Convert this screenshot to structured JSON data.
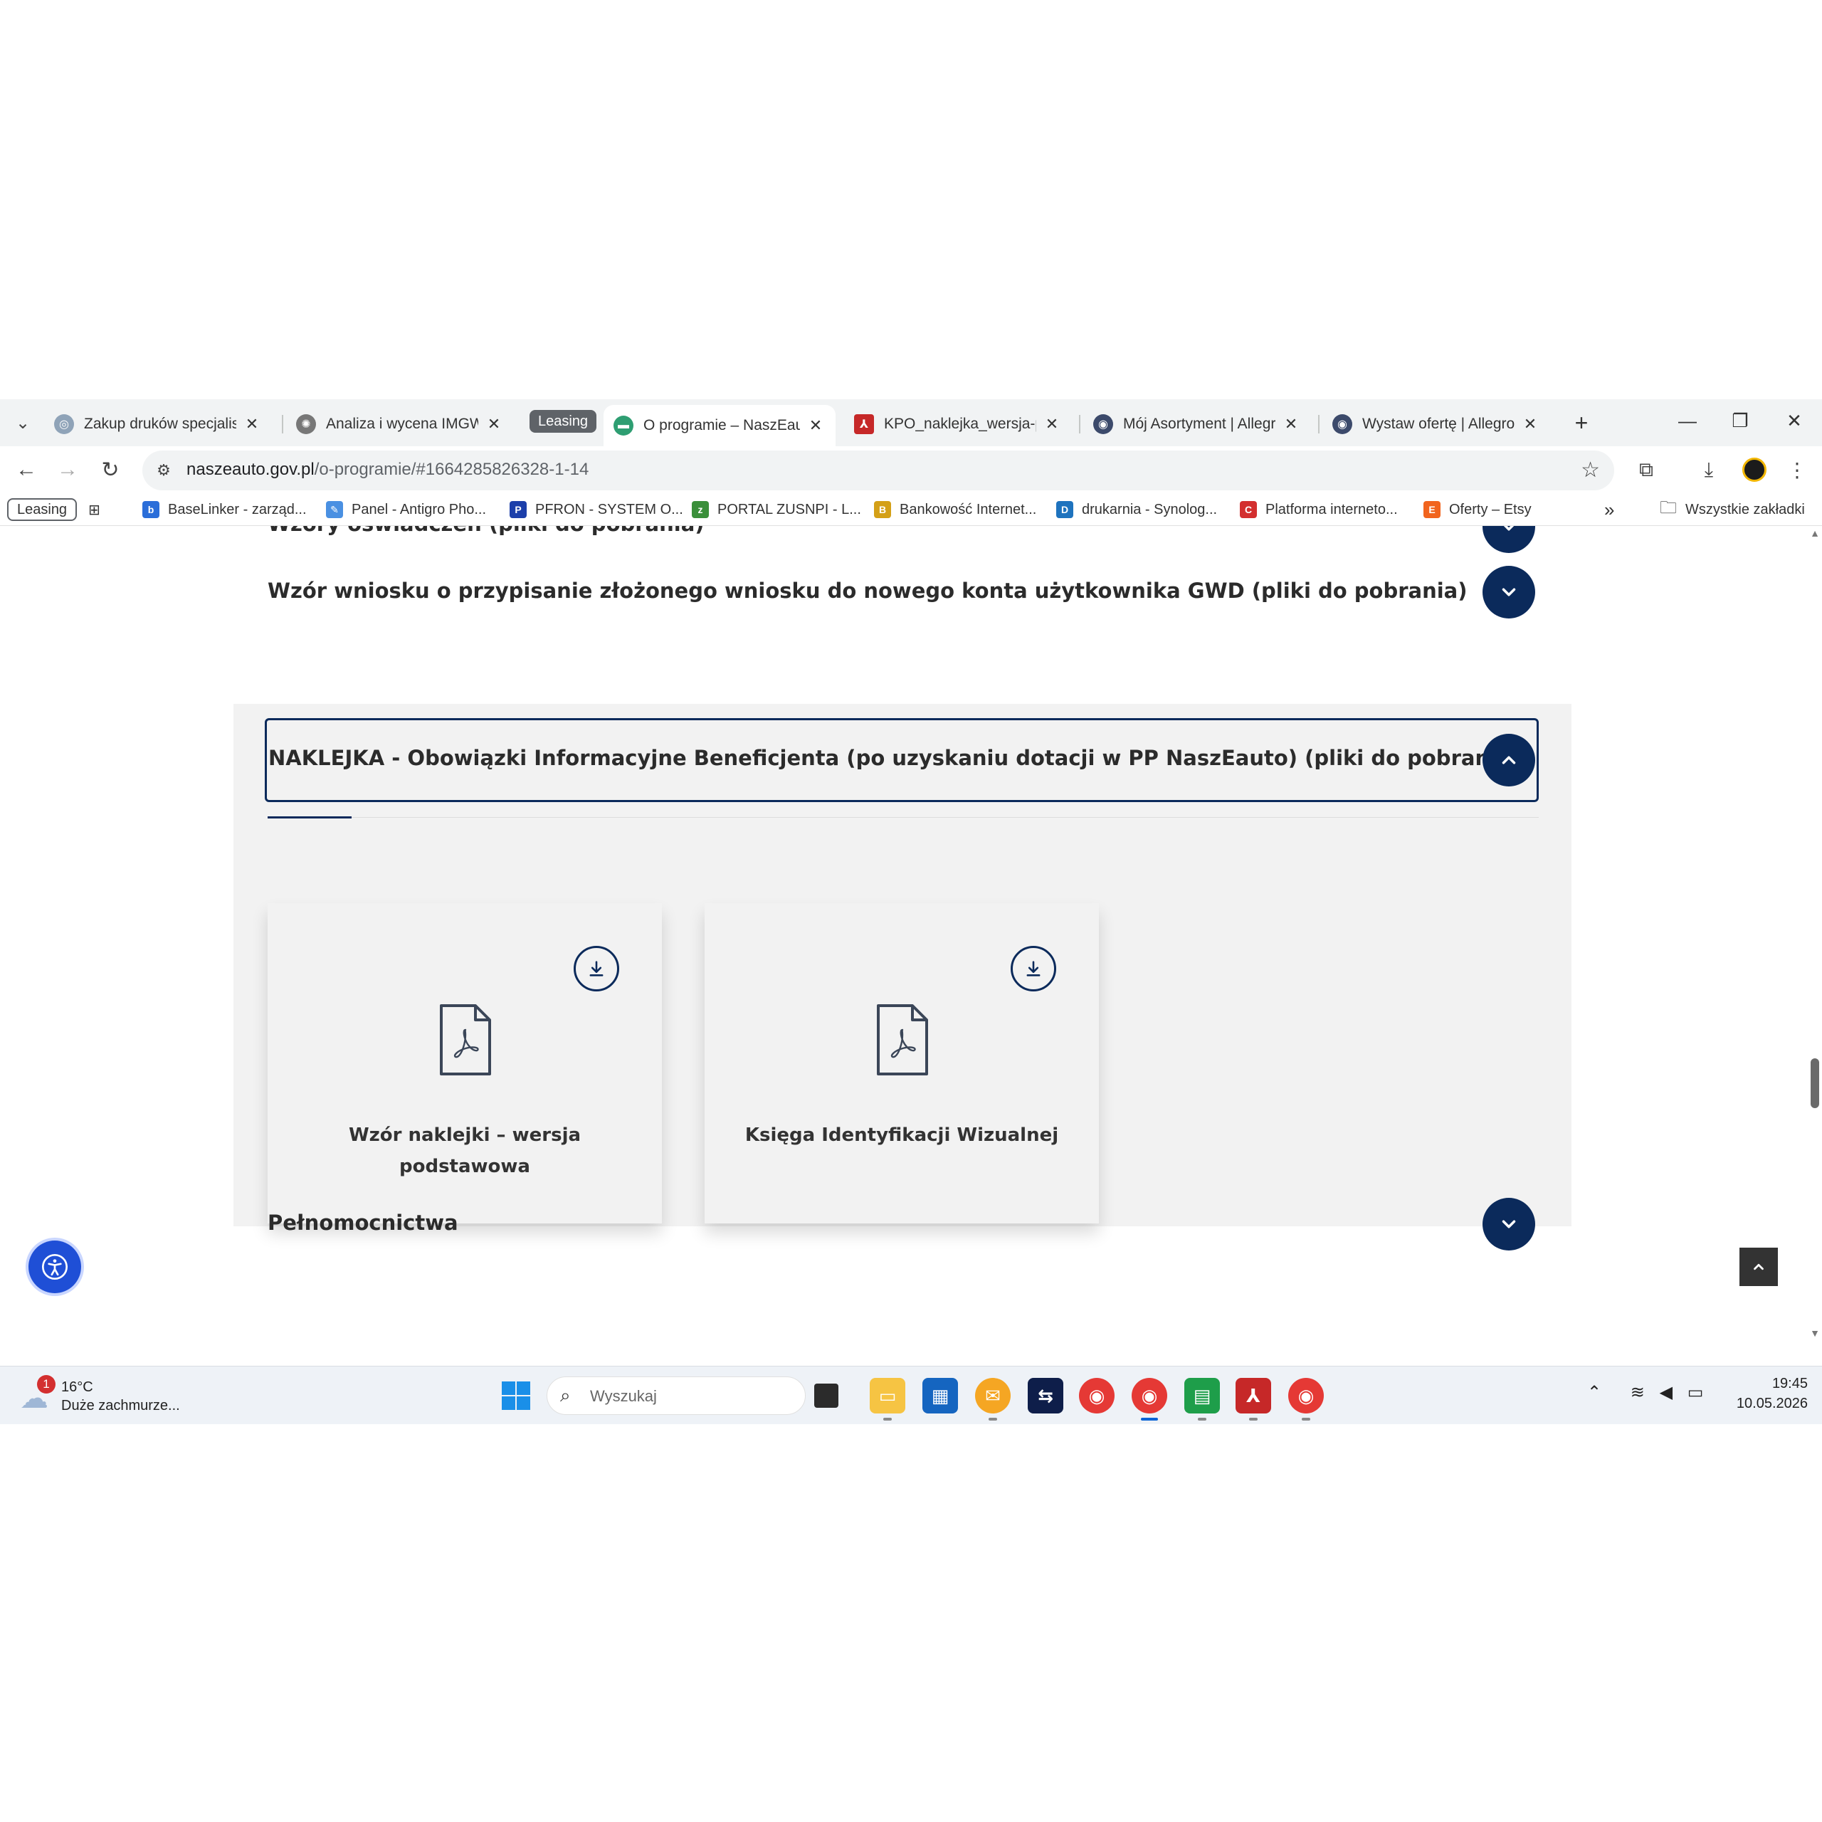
{
  "browser": {
    "tabs": [
      {
        "title": "Zakup druków specjalisty",
        "active": false
      },
      {
        "title": "Analiza i wycena IMGW",
        "active": false
      },
      {
        "title": "O programie – NaszEauto",
        "active": true
      },
      {
        "title": "KPO_naklejka_wersja-podstawowa",
        "active": false
      },
      {
        "title": "Mój Asortyment | Allegro",
        "active": false
      },
      {
        "title": "Wystaw ofertę | Allegro",
        "active": false
      }
    ],
    "tab_group_label": "Leasing",
    "url_domain": "naszeauto.gov.pl",
    "url_path": "/o-programie/#1664285826328-1-14",
    "bookmarks": {
      "group_label": "Leasing",
      "items": [
        "BaseLinker - zarząd...",
        "Panel - Antigro Pho...",
        "PFRON - SYSTEM O...",
        "PORTAL ZUSNPI - L...",
        "Bankowość Internet...",
        "drukarnia - Synolog...",
        "Platforma interneto...",
        "Oferty – Etsy"
      ],
      "overflow": "»",
      "all_bookmarks": "Wszystkie zakładki"
    }
  },
  "page": {
    "accordion_cut": "Wzory oświadczeń (pliki do pobrania)",
    "accordion_1": "Wzór wniosku o przypisanie złożonego wniosku do nowego konta użytkownika GWD (pliki do pobrania)",
    "accordion_expanded": "NAKLEJKA - Obowiązki Informacyjne Beneficjenta (po uzyskaniu dotacji w PP NaszEauto) (pliki do pobrania)",
    "accordion_last": "Pełnomocnictwa",
    "cards": [
      {
        "line1": "Wzór naklejki – wersja",
        "line2": "podstawowa"
      },
      {
        "line1": "Księga Identyfikacji Wizualnej",
        "line2": ""
      }
    ]
  },
  "taskbar": {
    "weather_badge": "1",
    "temperature": "16°C",
    "condition": "Duże zachmurze...",
    "search_placeholder": "Wyszukaj",
    "time": "19:45",
    "date": "10.05.2026"
  },
  "colors": {
    "accent_navy": "#0b2a5b",
    "panel_bg": "#f2f2f2",
    "accessibility_blue": "#1f4fd6"
  }
}
